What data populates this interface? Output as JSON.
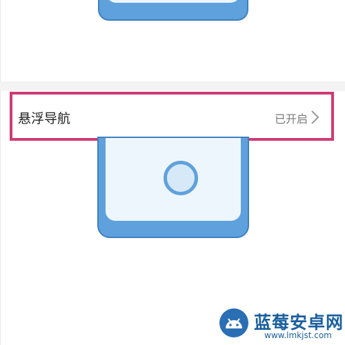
{
  "setting": {
    "label": "悬浮导航",
    "status": "已开启"
  },
  "icons": {
    "chevron": "chevron-right-icon",
    "float_ball": "floating-navigation-ball-icon",
    "watermark_logo": "android-robot-logo-icon"
  },
  "watermark": {
    "name": "蓝莓安卓网",
    "url": "www.lmkjst.com"
  },
  "colors": {
    "highlight": "#cf3b74",
    "phone_blue": "#5fa1dc",
    "status_gray": "#7a7a7a"
  }
}
